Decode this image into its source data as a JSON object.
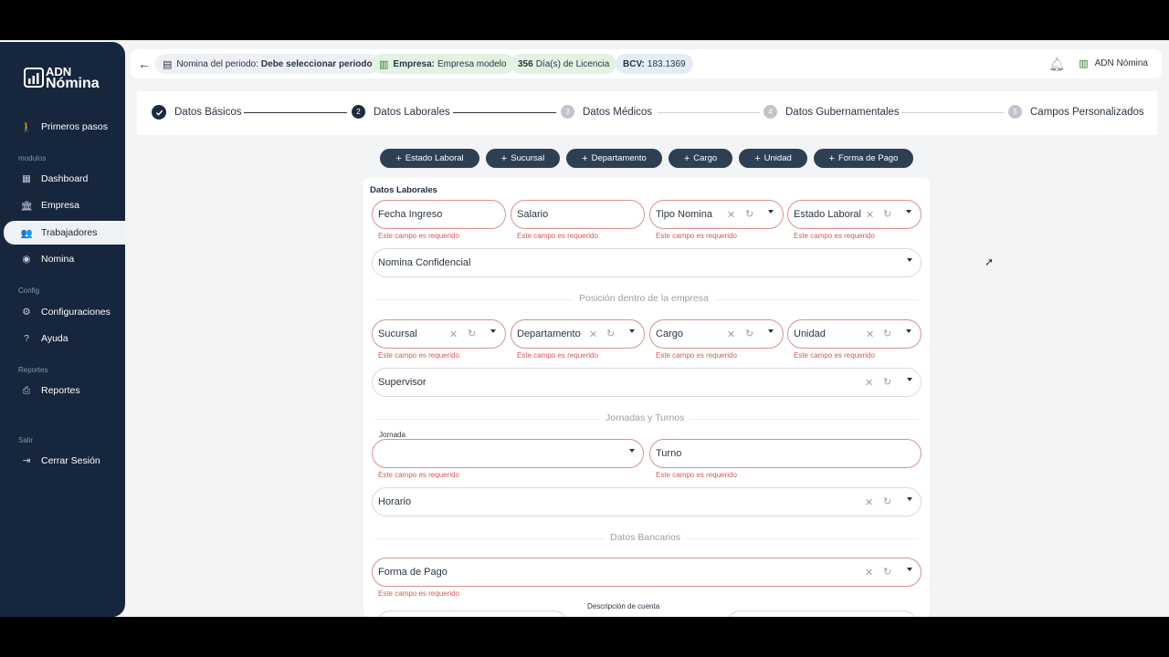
{
  "sidebar": {
    "logo": {
      "line1": "ADN",
      "line2": "Nómina"
    },
    "items": [
      {
        "label": "Primeros pasos",
        "icon": "walk-icon"
      },
      {
        "label": "Dashboard",
        "icon": "dashboard-icon"
      },
      {
        "label": "Empresa",
        "icon": "bank-icon"
      },
      {
        "label": "Trabajadores",
        "icon": "people-icon"
      },
      {
        "label": "Nomina",
        "icon": "coin-icon"
      },
      {
        "label": "Configuraciones",
        "icon": "gear-icon"
      },
      {
        "label": "Ayuda",
        "icon": "help-icon"
      },
      {
        "label": "Reportes",
        "icon": "printer-icon"
      },
      {
        "label": "Cerrar Sesión",
        "icon": "logout-icon"
      }
    ],
    "sections": [
      "modulos",
      "Config",
      "Reportes",
      "Salir"
    ],
    "active": "Trabajadores"
  },
  "topbar": {
    "period_label": "Nomina del periodo:",
    "period_value": "Debe seleccionar periodo",
    "company_label": "Empresa:",
    "company_value": "Empresa modelo",
    "license_count": "356",
    "license_label": "Día(s) de Licencia",
    "bcv_label": "BCV:",
    "bcv_value": "183.1369",
    "user_company": "ADN Nómina"
  },
  "stepper": {
    "steps": [
      {
        "num": "",
        "label": "Datos Básicos",
        "state": "done"
      },
      {
        "num": "2",
        "label": "Datos Laborales",
        "state": "current"
      },
      {
        "num": "3",
        "label": "Datos Médicos",
        "state": "pending"
      },
      {
        "num": "4",
        "label": "Datos Gubernamentales",
        "state": "pending"
      },
      {
        "num": "5",
        "label": "Campos Personalizados",
        "state": "pending"
      }
    ]
  },
  "actions": [
    "Estado Laboral",
    "Sucursal",
    "Departamento",
    "Cargo",
    "Unidad",
    "Forma de Pago"
  ],
  "form": {
    "title": "Datos Laborales",
    "error": "Este campo es requerido",
    "fields": {
      "fecha_ingreso": "Fecha Ingreso",
      "salario": "Salario",
      "tipo_nomina": "Tipo Nomina",
      "estado_laboral": "Estado Laboral",
      "nomina_confidencial": "Nomina Confidencial",
      "sucursal": "Sucursal",
      "departamento": "Departamento",
      "cargo": "Cargo",
      "unidad": "Unidad",
      "supervisor": "Supervisor",
      "jornada": "Jornada",
      "turno": "Turno",
      "horario": "Horario",
      "forma_pago": "Forma de Pago",
      "descripcion_cuenta": "Descripción de cuenta"
    },
    "sections": {
      "posicion": "Posición dentro de la empresa",
      "jornadas": "Jornadas y Turnos",
      "bancarios": "Datos Bancarios"
    }
  },
  "colors": {
    "sidebar": "#16263c",
    "button": "#2e3f54",
    "error": "#d35a55"
  }
}
